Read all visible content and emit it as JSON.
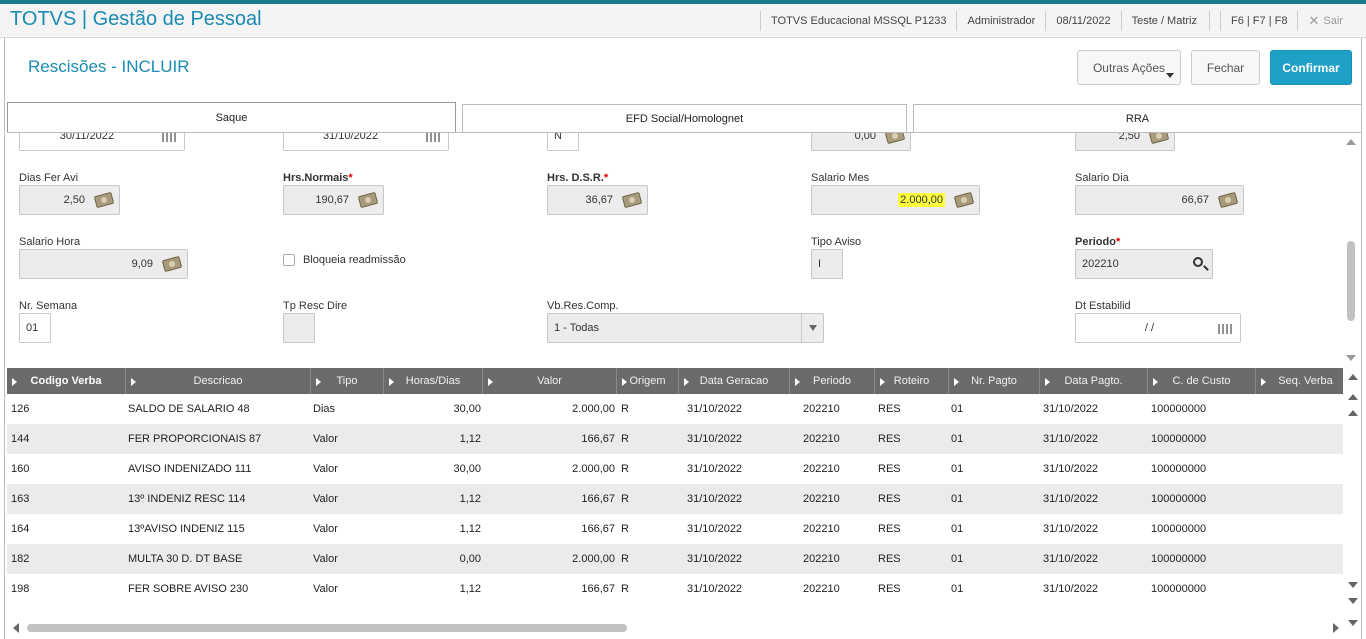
{
  "app": {
    "title": "TOTVS | Gestão de Pessoal"
  },
  "topbar": {
    "environment": "TOTVS Educacional MSSQL P1233",
    "user": "Administrador",
    "date": "08/11/2022",
    "branch": "Teste / Matriz",
    "shortcuts": "F6 | F7 | F8",
    "exit_label": "Sair"
  },
  "page": {
    "title": "Rescisões - INCLUIR"
  },
  "actions": {
    "more_label": "Outras Ações",
    "close_label": "Fechar",
    "confirm_label": "Confirmar"
  },
  "tabs": [
    {
      "label": "Saque"
    },
    {
      "label": "EFD Social/Homolognet"
    },
    {
      "label": "RRA"
    }
  ],
  "form": {
    "row0": {
      "date1": "30/11/2022",
      "date2": "31/10/2022",
      "flag": "N",
      "val1": "0,00",
      "val2": "2,50"
    },
    "dias_fer_avi": {
      "label": "Dias Fer Avi",
      "value": "2,50"
    },
    "hrs_normais": {
      "label": "Hrs.Normais",
      "value": "190,67"
    },
    "hrs_dsr": {
      "label": "Hrs. D.S.R.",
      "value": "36,67"
    },
    "salario_mes": {
      "label": "Salario Mes",
      "value": "2.000,00"
    },
    "salario_dia": {
      "label": "Salario Dia",
      "value": "66,67"
    },
    "salario_hora": {
      "label": "Salario Hora",
      "value": "9,09"
    },
    "bloqueia": {
      "label": "Bloqueia readmissão"
    },
    "tipo_aviso": {
      "label": "Tipo Aviso",
      "value": "I"
    },
    "periodo": {
      "label": "Periodo",
      "value": "202210"
    },
    "nr_semana": {
      "label": "Nr. Semana",
      "value": "01"
    },
    "tp_resc_dire": {
      "label": "Tp Resc Dire",
      "value": ""
    },
    "vb_res_comp": {
      "label": "Vb.Res.Comp.",
      "value": "1 - Todas"
    },
    "dt_estabilid": {
      "label": "Dt Estabilid",
      "value": "/  /"
    },
    "required_mark": "*"
  },
  "grid": {
    "columns": [
      "Codigo Verba",
      "Descricao",
      "Tipo",
      "Horas/Dias",
      "Valor",
      "Origem",
      "Data Geracao",
      "Periodo",
      "Roteiro",
      "Nr. Pagto",
      "Data Pagto.",
      "C. de Custo",
      "Seq. Verba"
    ],
    "rows": [
      [
        "126",
        "SALDO DE SALARIO 48",
        "Dias",
        "30,00",
        "2.000,00",
        "R",
        "31/10/2022",
        "202210",
        "RES",
        "01",
        "31/10/2022",
        "100000000"
      ],
      [
        "144",
        "FER PROPORCIONAIS 87",
        "Valor",
        "1,12",
        "166,67",
        "R",
        "31/10/2022",
        "202210",
        "RES",
        "01",
        "31/10/2022",
        "100000000"
      ],
      [
        "160",
        "AVISO INDENIZADO 111",
        "Valor",
        "30,00",
        "2.000,00",
        "R",
        "31/10/2022",
        "202210",
        "RES",
        "01",
        "31/10/2022",
        "100000000"
      ],
      [
        "163",
        "13º INDENIZ RESC 114",
        "Valor",
        "1,12",
        "166,67",
        "R",
        "31/10/2022",
        "202210",
        "RES",
        "01",
        "31/10/2022",
        "100000000"
      ],
      [
        "164",
        "13ºAVISO INDENIZ 115",
        "Valor",
        "1,12",
        "166,67",
        "R",
        "31/10/2022",
        "202210",
        "RES",
        "01",
        "31/10/2022",
        "100000000"
      ],
      [
        "182",
        "MULTA 30 D. DT BASE",
        "Valor",
        "0,00",
        "2.000,00",
        "R",
        "31/10/2022",
        "202210",
        "RES",
        "01",
        "31/10/2022",
        "100000000"
      ],
      [
        "198",
        "FER SOBRE AVISO 230",
        "Valor",
        "1,12",
        "166,67",
        "R",
        "31/10/2022",
        "202210",
        "RES",
        "01",
        "31/10/2022",
        "100000000"
      ]
    ]
  }
}
